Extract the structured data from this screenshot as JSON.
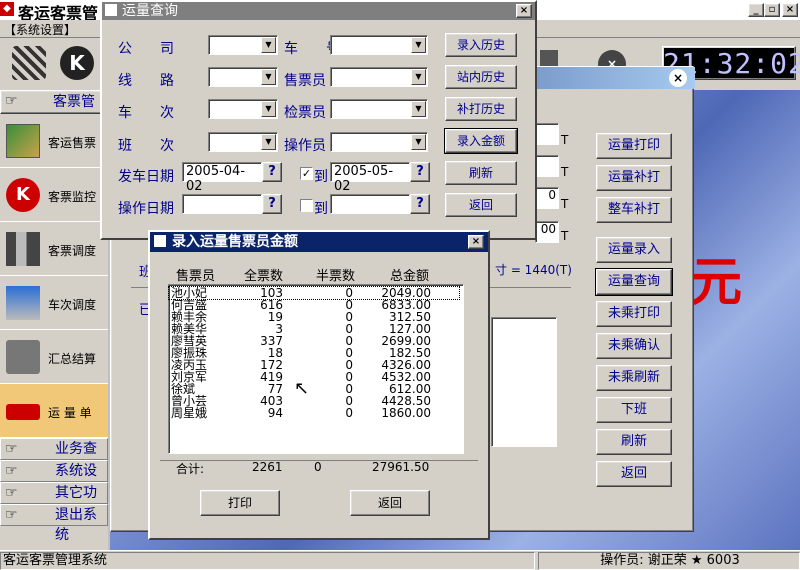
{
  "app": {
    "title": "客运客票管",
    "menu_system": "【系统设置】",
    "clock": "21:32:02"
  },
  "sidebar": {
    "top_label": "客票管",
    "items": [
      {
        "label": "客运售票",
        "icon": "map-icon"
      },
      {
        "label": "客票监控",
        "icon": "stop-sign-icon"
      },
      {
        "label": "客票调度",
        "icon": "people-icon"
      },
      {
        "label": "车次调度",
        "icon": "dispatch-icon"
      },
      {
        "label": "汇总结算",
        "icon": "calculator-icon"
      },
      {
        "label": "运 量 单",
        "icon": "bus-icon"
      }
    ],
    "links": [
      "业务查询",
      "系统设置",
      "其它功能",
      "退出系统"
    ]
  },
  "back_window": {
    "buttons": [
      "运量打印",
      "运量补打",
      "整车补打",
      "运量录入",
      "运量查询",
      "未乘打印",
      "未乘确认",
      "未乘刷新",
      "下班",
      "刷新",
      "返回"
    ],
    "t_marks": [
      "T",
      "T",
      "T",
      "T"
    ],
    "values": [
      "0",
      "00"
    ],
    "text_fragment": "寸 = 1440(T)",
    "label_fragments": [
      "班",
      "已"
    ]
  },
  "query": {
    "title": "运量查询",
    "labels": {
      "company": "公　　司",
      "plate": "车　　号",
      "route": "线　　路",
      "seller": "售票员",
      "train": "车　　次",
      "checker": "检票员",
      "shift": "班　　次",
      "operator": "操作员",
      "depart_date": "发车日期",
      "op_date": "操作日期",
      "to": "到"
    },
    "depart_from": "2005-04-02",
    "depart_to": "2005-05-02",
    "depart_checked": true,
    "op_checked": false,
    "buttons": [
      "录入历史",
      "站内历史",
      "补打历史",
      "录入金额",
      "刷新",
      "返回"
    ]
  },
  "amount": {
    "title": "录入运量售票员金额",
    "headers": [
      "售票员",
      "全票数",
      "半票数",
      "总金额"
    ],
    "rows": [
      [
        "池小妃",
        "103",
        "0",
        "2049.00"
      ],
      [
        "何吉盛",
        "616",
        "0",
        "6833.00"
      ],
      [
        "赖丰余",
        "19",
        "0",
        "312.50"
      ],
      [
        "赖美华",
        "3",
        "0",
        "127.00"
      ],
      [
        "廖彗英",
        "337",
        "0",
        "2699.00"
      ],
      [
        "廖振珠",
        "18",
        "0",
        "182.50"
      ],
      [
        "凌丙玉",
        "172",
        "0",
        "4326.00"
      ],
      [
        "刘京军",
        "419",
        "0",
        "4532.00"
      ],
      [
        "徐斌",
        "77",
        "0",
        "612.00"
      ],
      [
        "曾小芸",
        "403",
        "0",
        "4428.50"
      ],
      [
        "周星娥",
        "94",
        "0",
        "1860.00"
      ]
    ],
    "total_label": "合计:",
    "total_full": "2261",
    "total_half": "0",
    "total_amount": "27961.50",
    "print_label": "打印",
    "back_label": "返回"
  },
  "status": {
    "app_name": "客运客票管理系统",
    "operator": "操作员: 谢正荣 ★ 6003"
  }
}
